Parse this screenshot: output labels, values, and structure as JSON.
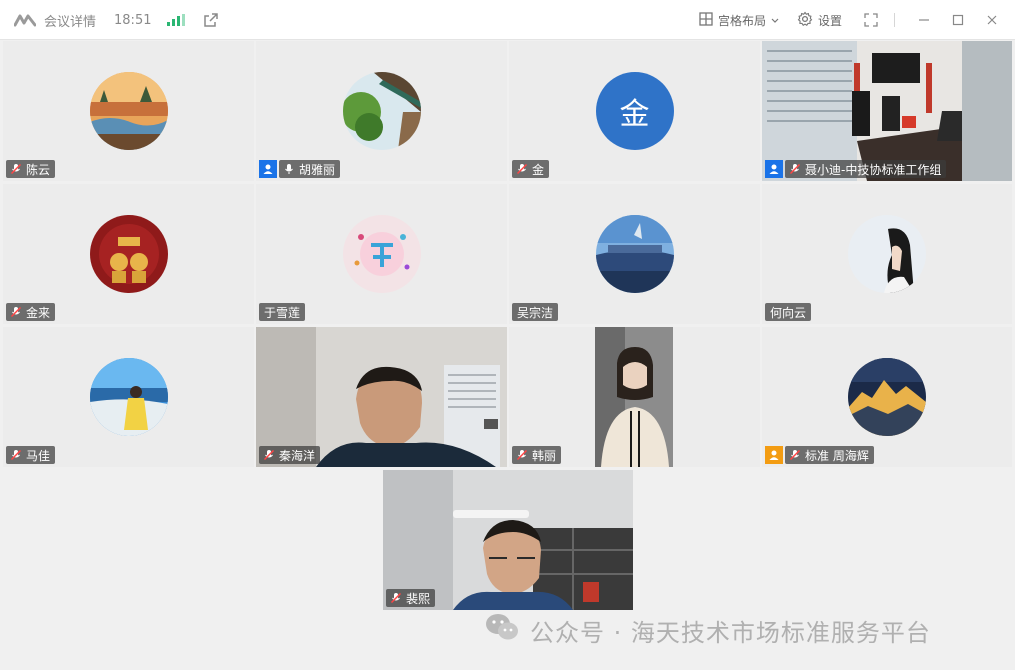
{
  "titlebar": {
    "title": "会议详情",
    "clock": "18:51",
    "layout_label": "宫格布局",
    "settings_label": "设置"
  },
  "participants": [
    {
      "name": "陈云",
      "mic": "muted",
      "role": "",
      "avatar": "landscape-river"
    },
    {
      "name": "胡雅丽",
      "mic": "active",
      "role": "host",
      "avatar": "tree-eaves"
    },
    {
      "name": "金",
      "mic": "muted",
      "role": "",
      "avatar": "initial",
      "initial": "金"
    },
    {
      "name": "聂小迪-中技协标准工作组",
      "mic": "muted",
      "role": "host",
      "avatar": "video-office"
    },
    {
      "name": "金来",
      "mic": "muted",
      "role": "",
      "avatar": "red-new-year"
    },
    {
      "name": "于雪莲",
      "mic": "none",
      "role": "",
      "avatar": "pink-logo"
    },
    {
      "name": "吴宗洁",
      "mic": "none",
      "role": "",
      "avatar": "blue-sky-roof"
    },
    {
      "name": "何向云",
      "mic": "none",
      "role": "",
      "avatar": "girl-portrait"
    },
    {
      "name": "马佳",
      "mic": "muted",
      "role": "",
      "avatar": "beach-girl"
    },
    {
      "name": "秦海洋",
      "mic": "muted",
      "role": "",
      "avatar": "video-man"
    },
    {
      "name": "韩丽",
      "mic": "muted",
      "role": "",
      "avatar": "video-woman"
    },
    {
      "name": "标准 周海辉",
      "mic": "muted",
      "role": "cohost",
      "avatar": "sunset-mountain"
    },
    {
      "name": "裴熙",
      "mic": "muted",
      "role": "",
      "avatar": "video-man-office"
    }
  ],
  "watermark": {
    "text": "公众号 · 海天技术市场标准服务平台"
  },
  "colors": {
    "accent": "#1a73e8",
    "cohost": "#f39c12",
    "signal": "#2bb673",
    "initial_avatar": "#2f73c8"
  }
}
